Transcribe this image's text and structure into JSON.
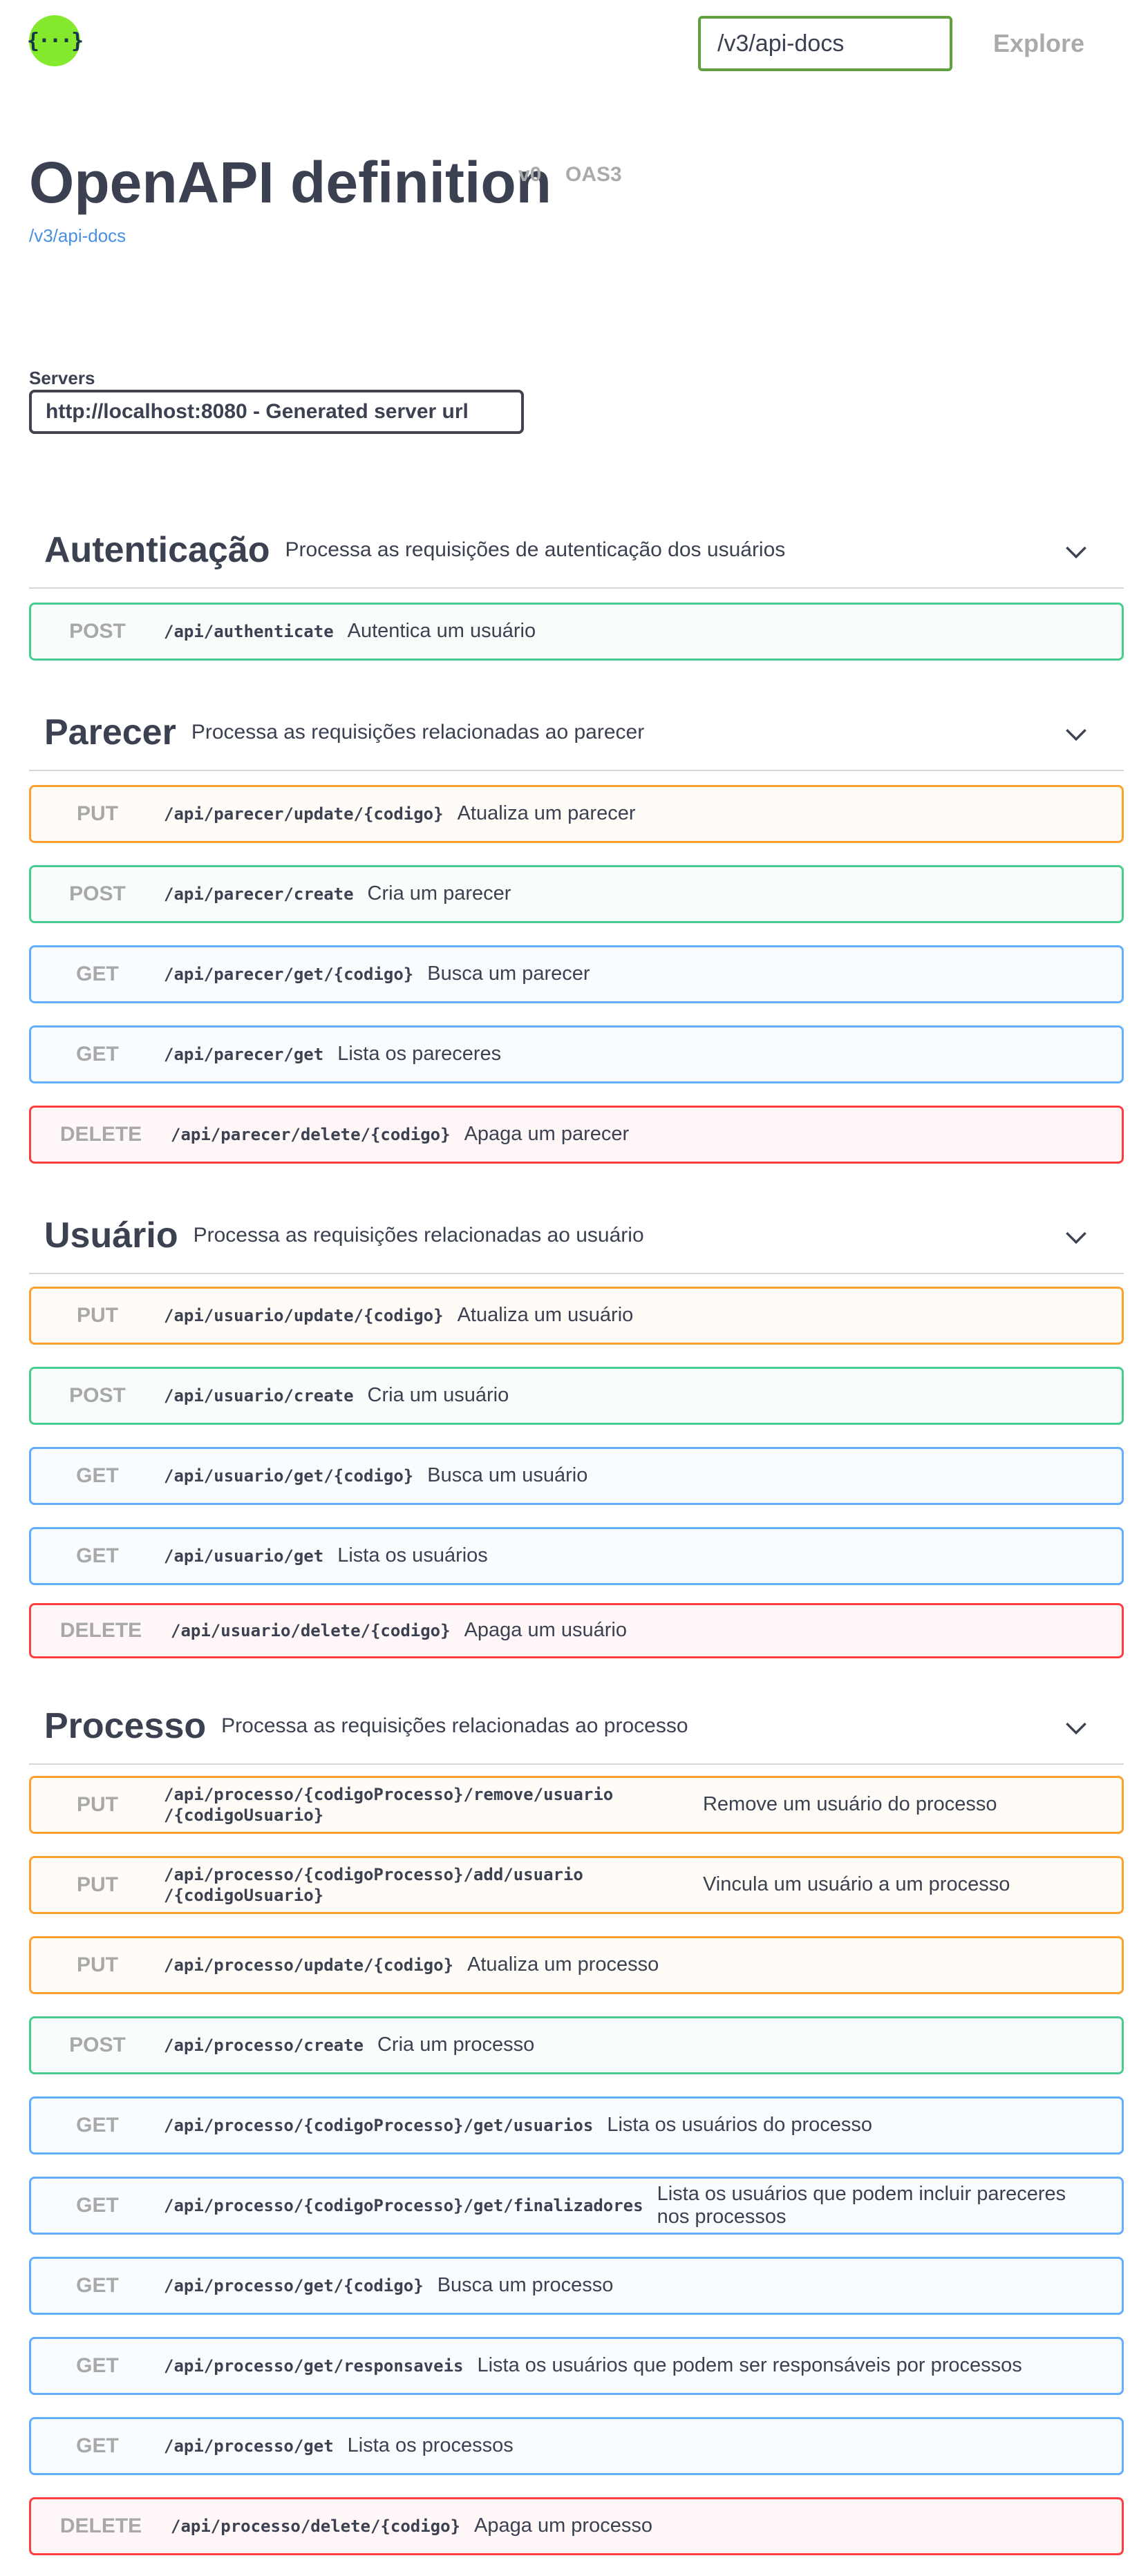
{
  "topbar": {
    "logo_glyph": "{···}",
    "url_value": "/v3/api-docs",
    "explore_label": "Explore"
  },
  "info": {
    "title": "OpenAPI definition",
    "version": "v0",
    "oas": "OAS3",
    "spec_link": "/v3/api-docs"
  },
  "servers": {
    "label": "Servers",
    "selected": "http://localhost:8080 - Generated server url"
  },
  "colors": {
    "post": "#49cc90",
    "put": "#fca130",
    "get": "#61afe",
    "delete": "#f93e3e",
    "accent_green": "#62a03f",
    "logo": "#85ea2d"
  },
  "tags": [
    {
      "name": "Autenticação",
      "description": "Processa as requisições de autenticação dos usuários",
      "icon": "chevron-down-icon",
      "operations": [
        {
          "method": "POST",
          "path": "/api/authenticate",
          "summary": "Autentica um usuário"
        }
      ]
    },
    {
      "name": "Parecer",
      "description": "Processa as requisições relacionadas ao parecer",
      "icon": "chevron-down-icon",
      "operations": [
        {
          "method": "PUT",
          "path": "/api/parecer/update/{codigo}",
          "summary": "Atualiza um parecer"
        },
        {
          "method": "POST",
          "path": "/api/parecer/create",
          "summary": "Cria um parecer"
        },
        {
          "method": "GET",
          "path": "/api/parecer/get/{codigo}",
          "summary": "Busca um parecer"
        },
        {
          "method": "GET",
          "path": "/api/parecer/get",
          "summary": "Lista os pareceres"
        },
        {
          "method": "DELETE",
          "path": "/api/parecer/delete/{codigo}",
          "summary": "Apaga um parecer"
        }
      ]
    },
    {
      "name": "Usuário",
      "description": "Processa as requisições relacionadas ao usuário",
      "icon": "chevron-down-icon",
      "operations": [
        {
          "method": "PUT",
          "path": "/api/usuario/update/{codigo}",
          "summary": "Atualiza um usuário"
        },
        {
          "method": "POST",
          "path": "/api/usuario/create",
          "summary": "Cria um usuário"
        },
        {
          "method": "GET",
          "path": "/api/usuario/get/{codigo}",
          "summary": "Busca um usuário"
        },
        {
          "method": "GET",
          "path": "/api/usuario/get",
          "summary": "Lista os usuários"
        },
        {
          "method": "DELETE",
          "path": "/api/usuario/delete/{codigo}",
          "summary": "Apaga um usuário"
        }
      ]
    },
    {
      "name": "Processo",
      "description": "Processa as requisições relacionadas ao processo",
      "icon": "chevron-down-icon",
      "operations": [
        {
          "method": "PUT",
          "path": "/api/processo/{codigoProcesso}/remove/usuario /{codigoUsuario}",
          "summary": "Remove um usuário do processo"
        },
        {
          "method": "PUT",
          "path": "/api/processo/{codigoProcesso}/add/usuario /{codigoUsuario}",
          "summary": "Vincula um usuário a um processo"
        },
        {
          "method": "PUT",
          "path": "/api/processo/update/{codigo}",
          "summary": "Atualiza um processo"
        },
        {
          "method": "POST",
          "path": "/api/processo/create",
          "summary": "Cria um processo"
        },
        {
          "method": "GET",
          "path": "/api/processo/{codigoProcesso}/get/usuarios",
          "summary": "Lista os usuários do processo"
        },
        {
          "method": "GET",
          "path": "/api/processo/{codigoProcesso}/get/finalizadores",
          "summary": "Lista os usuários que podem incluir pareceres nos processos"
        },
        {
          "method": "GET",
          "path": "/api/processo/get/{codigo}",
          "summary": "Busca um processo"
        },
        {
          "method": "GET",
          "path": "/api/processo/get/responsaveis",
          "summary": "Lista os usuários que podem ser responsáveis por processos"
        },
        {
          "method": "GET",
          "path": "/api/processo/get",
          "summary": "Lista os processos"
        },
        {
          "method": "DELETE",
          "path": "/api/processo/delete/{codigo}",
          "summary": "Apaga um processo"
        }
      ]
    }
  ]
}
